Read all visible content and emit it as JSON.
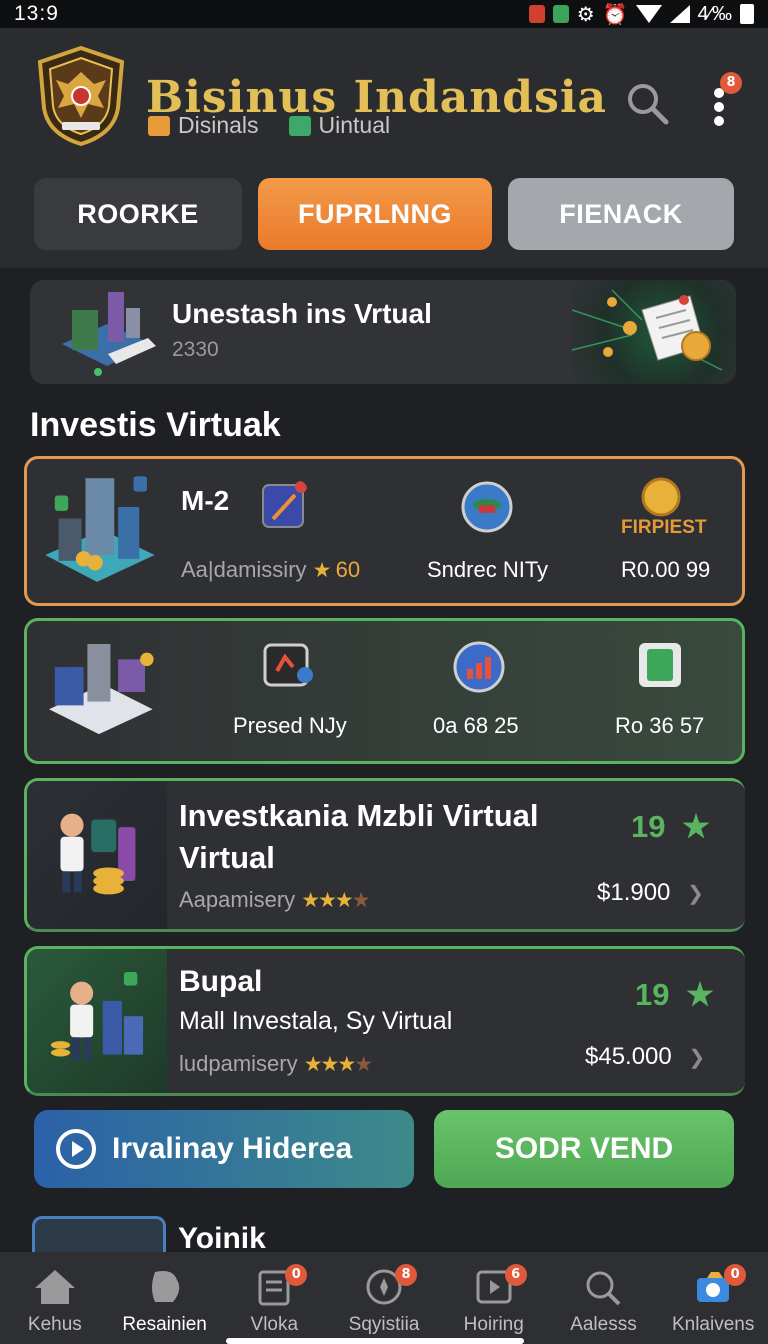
{
  "status_bar": {
    "time": "13:9",
    "right_text": "4∕‰"
  },
  "header": {
    "title": "Bisinus Indandsia",
    "subtabs": [
      {
        "label": "Disinals",
        "icon": "package-icon",
        "color": "#e79a3a"
      },
      {
        "label": "Uintual",
        "icon": "box-icon",
        "color": "#3ea86a"
      }
    ],
    "notification_count": "8"
  },
  "segments": [
    {
      "label": "ROORKE"
    },
    {
      "label": "FUPRLNNG",
      "active": true
    },
    {
      "label": "FIENACK"
    }
  ],
  "banner": {
    "title": "Unestash ins Vrtual",
    "subtitle": "2330"
  },
  "section_title": "Investis Virtuak",
  "cards": [
    {
      "title": "M-2",
      "meta": "Aa|damissiry",
      "rating": "60",
      "center_label": "Sndrec NITy",
      "right_tag": "FIRPIEST",
      "right_value": "R0.00 99"
    },
    {
      "label1": "Presed NJy",
      "label2": "0a 68 25",
      "label3": "Ro 36 57"
    },
    {
      "title_line1": "Investkania Mzbli Virtual",
      "title_line2": "Virtual",
      "meta": "Aapamisery",
      "score": "19",
      "price": "$1.900"
    },
    {
      "title": "Bupal",
      "subtitle": "Mall Investala, Sy Virtual",
      "meta": "ludpamisery",
      "score": "19",
      "price": "$45.000"
    }
  ],
  "actions": {
    "left_label": "Irvalinay Hiderea",
    "right_label": "SODR VEND"
  },
  "peek_title": "Yoinik",
  "bottom_nav": [
    {
      "label": "Kehus",
      "icon": "home-icon",
      "badge": ""
    },
    {
      "label": "Resainien",
      "icon": "puzzle-icon",
      "badge": "",
      "active": true
    },
    {
      "label": "Vloka",
      "icon": "list-icon",
      "badge": "0"
    },
    {
      "label": "Sqyistiia",
      "icon": "compass-icon",
      "badge": "8"
    },
    {
      "label": "Hoiring",
      "icon": "play-icon",
      "badge": "6"
    },
    {
      "label": "Aalesss",
      "icon": "search-icon",
      "badge": ""
    },
    {
      "label": "Knlaivens",
      "icon": "camera-icon",
      "badge": "0"
    }
  ]
}
